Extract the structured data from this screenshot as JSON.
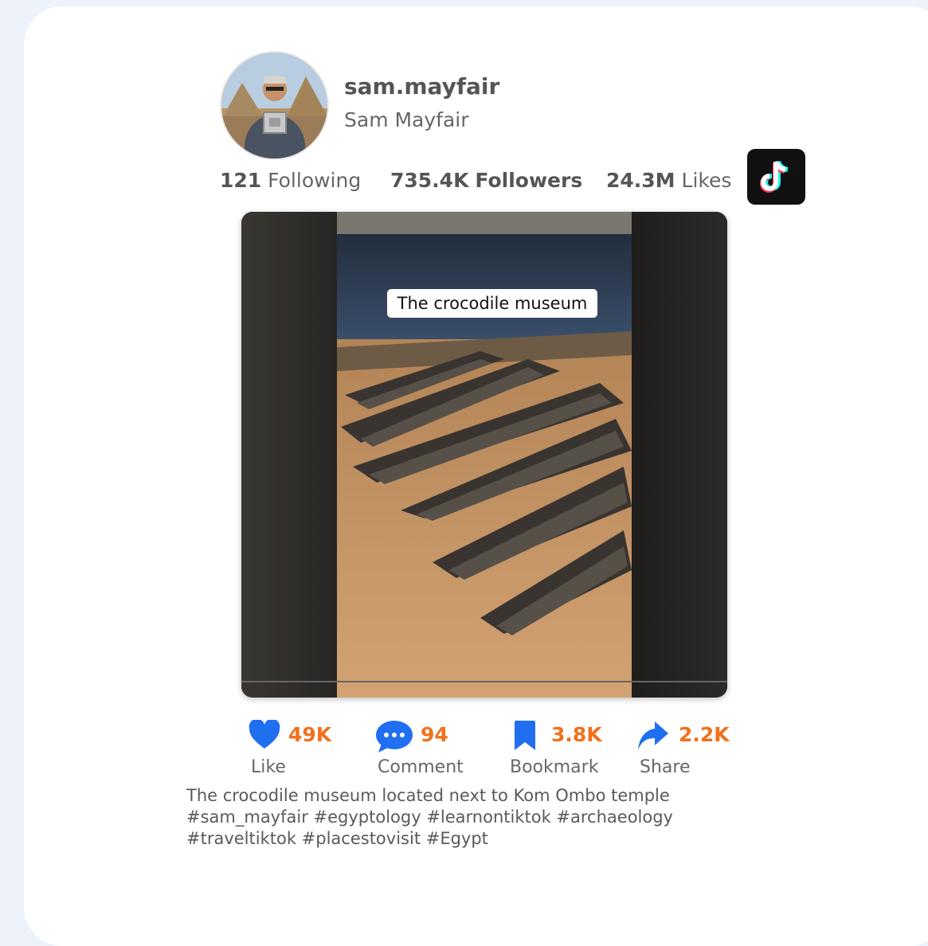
{
  "profile": {
    "username": "sam.mayfair",
    "display_name": "Sam Mayfair",
    "avatar_icon": "profile-photo"
  },
  "stats": {
    "following_count": "121",
    "following_label": "Following",
    "followers_count": "735.4K",
    "followers_label": "Followers",
    "likes_count": "24.3M",
    "likes_label": "Likes"
  },
  "brand": {
    "logo_icon": "tiktok-logo-icon",
    "accent": "#f2701c",
    "icon_blue": "#1f6ff0"
  },
  "video": {
    "overlay_text": "The crocodile museum"
  },
  "actions": [
    {
      "icon": "heart-icon",
      "count": "49K",
      "label": "Like"
    },
    {
      "icon": "comment-icon",
      "count": "94",
      "label": "Comment"
    },
    {
      "icon": "bookmark-icon",
      "count": "3.8K",
      "label": "Bookmark"
    },
    {
      "icon": "share-icon",
      "count": "2.2K",
      "label": "Share"
    }
  ],
  "description": "The crocodile museum located next to Kom Ombo temple #sam_mayfair #egyptology #learnontiktok #archaeology #traveltiktok #placestovisit #Egypt"
}
